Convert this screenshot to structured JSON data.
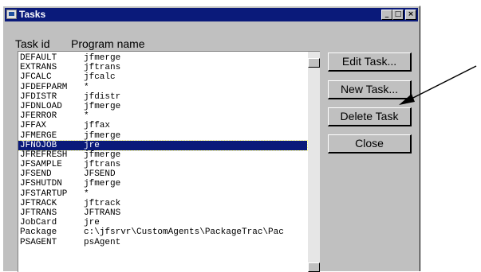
{
  "window": {
    "title": "Tasks"
  },
  "titlebar_buttons": {
    "minimize": "_",
    "maximize": "□",
    "close": "×"
  },
  "columns": {
    "task_id": "Task id",
    "program_name": "Program name"
  },
  "tasks": [
    {
      "id": "DEFAULT",
      "program": "jfmerge"
    },
    {
      "id": "EXTRANS",
      "program": "jftrans"
    },
    {
      "id": "JFCALC",
      "program": "jfcalc"
    },
    {
      "id": "JFDEFPARM",
      "program": "*"
    },
    {
      "id": "JFDISTR",
      "program": "jfdistr"
    },
    {
      "id": "JFDNLOAD",
      "program": "jfmerge"
    },
    {
      "id": "JFERROR",
      "program": "*"
    },
    {
      "id": "JFFAX",
      "program": "jffax"
    },
    {
      "id": "JFMERGE",
      "program": "jfmerge"
    },
    {
      "id": "JFNOJOB",
      "program": "jre",
      "selected": true
    },
    {
      "id": "JFREFRESH",
      "program": "jfmerge"
    },
    {
      "id": "JFSAMPLE",
      "program": "jftrans"
    },
    {
      "id": "JFSEND",
      "program": "JFSEND"
    },
    {
      "id": "JFSHUTDN",
      "program": "jfmerge"
    },
    {
      "id": "JFSTARTUP",
      "program": "*"
    },
    {
      "id": "JFTRACK",
      "program": "jftrack"
    },
    {
      "id": "JFTRANS",
      "program": "JFTRANS"
    },
    {
      "id": "JobCard",
      "program": "jre"
    },
    {
      "id": "Package",
      "program": "c:\\jfsrvr\\CustomAgents\\PackageTrac\\Pac"
    },
    {
      "id": "PSAGENT",
      "program": "psAgent"
    }
  ],
  "buttons": {
    "edit": "Edit Task...",
    "new": "New Task...",
    "delete": "Delete Task",
    "close": "Close"
  },
  "colors": {
    "titlebar": "#0a1a7a",
    "selection": "#0a1a7a",
    "face": "#c0c0c0"
  }
}
